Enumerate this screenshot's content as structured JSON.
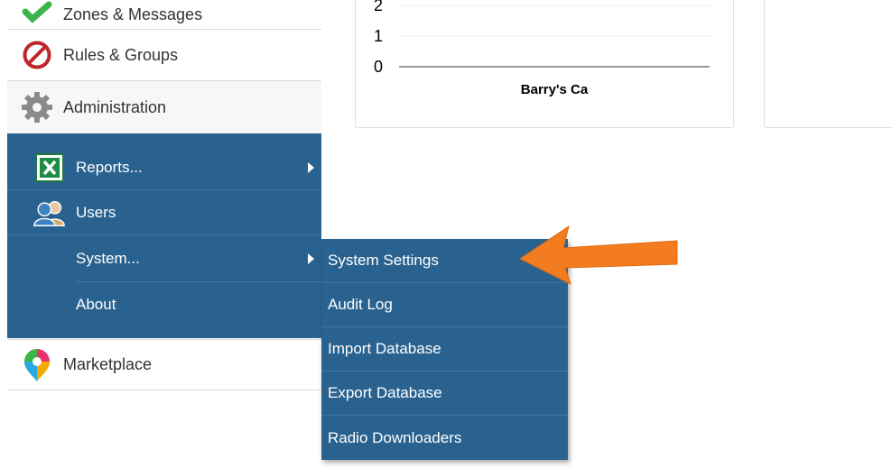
{
  "sidebar": {
    "items": [
      {
        "label": "Zones & Messages",
        "icon": "zones-icon"
      },
      {
        "label": "Rules & Groups",
        "icon": "no-entry-icon"
      },
      {
        "label": "Administration",
        "icon": "gear-icon"
      },
      {
        "label": "Marketplace",
        "icon": "marketplace-pin-icon"
      }
    ]
  },
  "admin_menu": {
    "items": [
      {
        "label": "Reports...",
        "icon": "excel-icon",
        "has_submenu": true
      },
      {
        "label": "Users",
        "icon": "users-icon",
        "has_submenu": false
      },
      {
        "label": "System...",
        "icon": "",
        "has_submenu": true
      },
      {
        "label": "About",
        "icon": "",
        "has_submenu": false
      }
    ]
  },
  "system_menu": {
    "items": [
      {
        "label": "System Settings"
      },
      {
        "label": "Audit Log"
      },
      {
        "label": "Import Database"
      },
      {
        "label": "Export Database"
      },
      {
        "label": "Radio Downloaders"
      }
    ]
  },
  "chart_data": {
    "type": "bar",
    "categories": [
      "Barry's Ca"
    ],
    "values": [
      0
    ],
    "y_ticks": [
      "0",
      "1",
      "2"
    ],
    "ylim": [
      0,
      2
    ],
    "grid": true
  },
  "colors": {
    "menu_bg": "#2a628f",
    "arrow": "#f47c20"
  }
}
